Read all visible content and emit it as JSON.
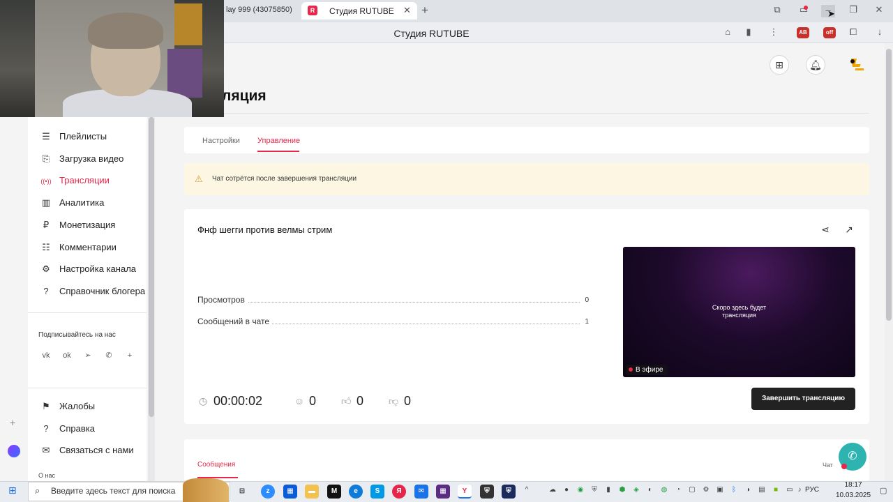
{
  "browser": {
    "prev_tab_title": "lay 999 (43075850)",
    "active_tab_title": "Студия RUTUBE",
    "page_title": "Студия RUTUBE",
    "new_tab": "+",
    "close_tab": "✕"
  },
  "header": {
    "page_heading": "ляция",
    "add_button_icon": "plus-square-icon",
    "bell_icon": "bell-icon"
  },
  "sidebar": {
    "items": [
      {
        "label": "Плейлисты",
        "icon": "☰",
        "active": false
      },
      {
        "label": "Загрузка видео",
        "icon": "⎘",
        "active": false
      },
      {
        "label": "Трансляции",
        "icon": "((•))",
        "active": true
      },
      {
        "label": "Аналитика",
        "icon": "▥",
        "active": false
      },
      {
        "label": "Монетизация",
        "icon": "₽",
        "active": false
      },
      {
        "label": "Комментарии",
        "icon": "☷",
        "active": false
      },
      {
        "label": "Настройка канала",
        "icon": "⚙",
        "active": false
      },
      {
        "label": "Справочник блогера",
        "icon": "?",
        "active": false
      }
    ],
    "subscribe_label": "Подписывайтесь на нас",
    "social": [
      "vk",
      "ok",
      "telegram",
      "viber",
      "plus"
    ],
    "bottom_items": [
      {
        "label": "Жалобы",
        "icon": "⚑"
      },
      {
        "label": "Справка",
        "icon": "?"
      },
      {
        "label": "Связаться с нами",
        "icon": "✉"
      }
    ],
    "about": "О нас"
  },
  "tabs": {
    "settings": "Настройки",
    "management": "Управление",
    "active": "management"
  },
  "warning": {
    "text": "Чат сотрётся после завершения трансляции"
  },
  "stream": {
    "title": "Фнф шегги против велмы стрим",
    "stats": [
      {
        "label": "Просмотров",
        "value": "0"
      },
      {
        "label": "Сообщений в чате",
        "value": "1"
      }
    ],
    "preview_text_line1": "Скоро здесь будет",
    "preview_text_line2": "трансляция",
    "live_badge": "В эфире",
    "duration": "00:00:02",
    "viewers": "0",
    "likes": "0",
    "dislikes": "0",
    "end_button": "Завершить трансляцию"
  },
  "messages": {
    "tab": "Сообщения",
    "chat_label": "Чат"
  },
  "taskbar": {
    "search_placeholder": "Введите здесь текст для поиска",
    "language": "РУС",
    "time": "18:17",
    "date": "10.03.2025"
  },
  "colors": {
    "accent": "#e8264a",
    "warning_bg": "#fdf6e3",
    "button_dark": "#222222",
    "support": "#2db3b0"
  }
}
